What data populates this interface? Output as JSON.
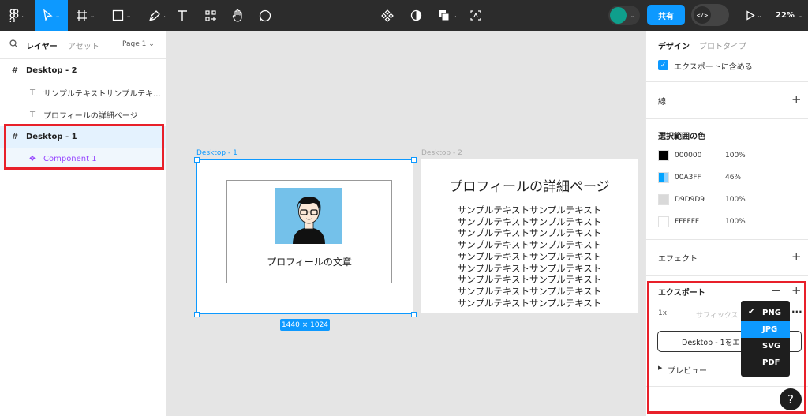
{
  "toolbar": {
    "main_menu_icon": "figma-logo-icon",
    "tools": [
      "move-tool-icon",
      "frame-tool-icon",
      "shape-tool-icon",
      "pen-tool-icon",
      "text-tool-icon",
      "resources-icon",
      "hand-tool-icon",
      "comment-icon"
    ],
    "center_tools": [
      "component-icon",
      "mask-icon",
      "boolean-icon",
      "crop-icon"
    ],
    "share_label": "共有",
    "dev_mode_glyph": "</>",
    "zoom": "22%",
    "accent": "#0d99ff",
    "user_color": "#0f9f8c"
  },
  "left_panel": {
    "tabs": {
      "layers": "レイヤー",
      "assets": "アセット"
    },
    "page_selector": "Page 1 ⌄",
    "layers": [
      {
        "icon": "#",
        "name": "Desktop - 2",
        "kind": "frame"
      },
      {
        "icon": "T",
        "name": "サンプルテキストサンプルテキ...",
        "kind": "text"
      },
      {
        "icon": "T",
        "name": "プロフィールの詳細ページ",
        "kind": "text"
      },
      {
        "icon": "#",
        "name": "Desktop - 1",
        "kind": "frame"
      },
      {
        "icon": "❖",
        "name": "Component 1",
        "kind": "component"
      }
    ]
  },
  "canvas": {
    "frame1_label": "Desktop - 1",
    "frame2_label": "Desktop - 2",
    "card_text": "プロフィールの文章",
    "size_badge": "1440 × 1024",
    "frame2_title": "プロフィールの詳細ページ",
    "frame2_lines": [
      "サンプルテキストサンプルテキスト",
      "サンプルテキストサンプルテキスト",
      "サンプルテキストサンプルテキスト",
      "サンプルテキストサンプルテキスト",
      "サンプルテキストサンプルテキスト",
      "サンプルテキストサンプルテキスト",
      "サンプルテキストサンプルテキスト",
      "サンプルテキストサンプルテキスト",
      "サンプルテキストサンプルテキスト"
    ]
  },
  "right_panel": {
    "tabs": {
      "design": "デザイン",
      "prototype": "プロトタイプ"
    },
    "include_export_label": "エクスポートに含める",
    "stroke_label": "線",
    "selection_colors_title": "選択範囲の色",
    "colors": [
      {
        "hex": "000000",
        "opacity": "100%",
        "swatch": "#000000"
      },
      {
        "hex": "00A3FF",
        "opacity": "46%",
        "swatch": "#00A3FF"
      },
      {
        "hex": "D9D9D9",
        "opacity": "100%",
        "swatch": "#D9D9D9"
      },
      {
        "hex": "FFFFFF",
        "opacity": "100%",
        "swatch": "#FFFFFF"
      }
    ],
    "effects_label": "エフェクト",
    "export_title": "エクスポート",
    "export_scale": "1x",
    "suffix_placeholder": "サフィックス",
    "more": "···",
    "export_button": "Desktop - 1をエ",
    "preview_label": "プレビュー",
    "formats": [
      "PNG",
      "JPG",
      "SVG",
      "PDF"
    ],
    "checked_format": "PNG",
    "highlighted_format": "JPG",
    "help": "?"
  }
}
